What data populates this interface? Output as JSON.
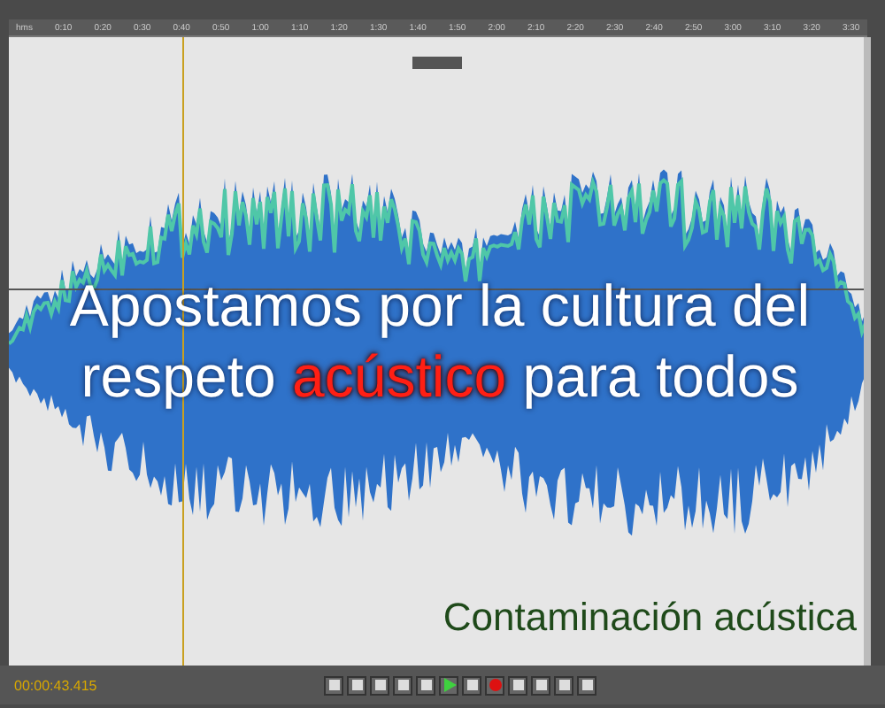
{
  "ruler": {
    "labels": [
      "hms",
      "0:10",
      "0:20",
      "0:30",
      "0:40",
      "0:50",
      "1:00",
      "1:10",
      "1:20",
      "1:30",
      "1:40",
      "1:50",
      "2:00",
      "2:10",
      "2:20",
      "2:30",
      "2:40",
      "2:50",
      "3:00",
      "3:10",
      "3:20",
      "3:30"
    ]
  },
  "headline": {
    "parts": [
      {
        "text": "Apostamos por la cultura del respeto ",
        "highlight": false
      },
      {
        "text": "acústico",
        "highlight": true
      },
      {
        "text": " para todos",
        "highlight": false
      }
    ]
  },
  "caption": "Contaminación acústica",
  "transport": {
    "time": "00:00:43.415"
  }
}
